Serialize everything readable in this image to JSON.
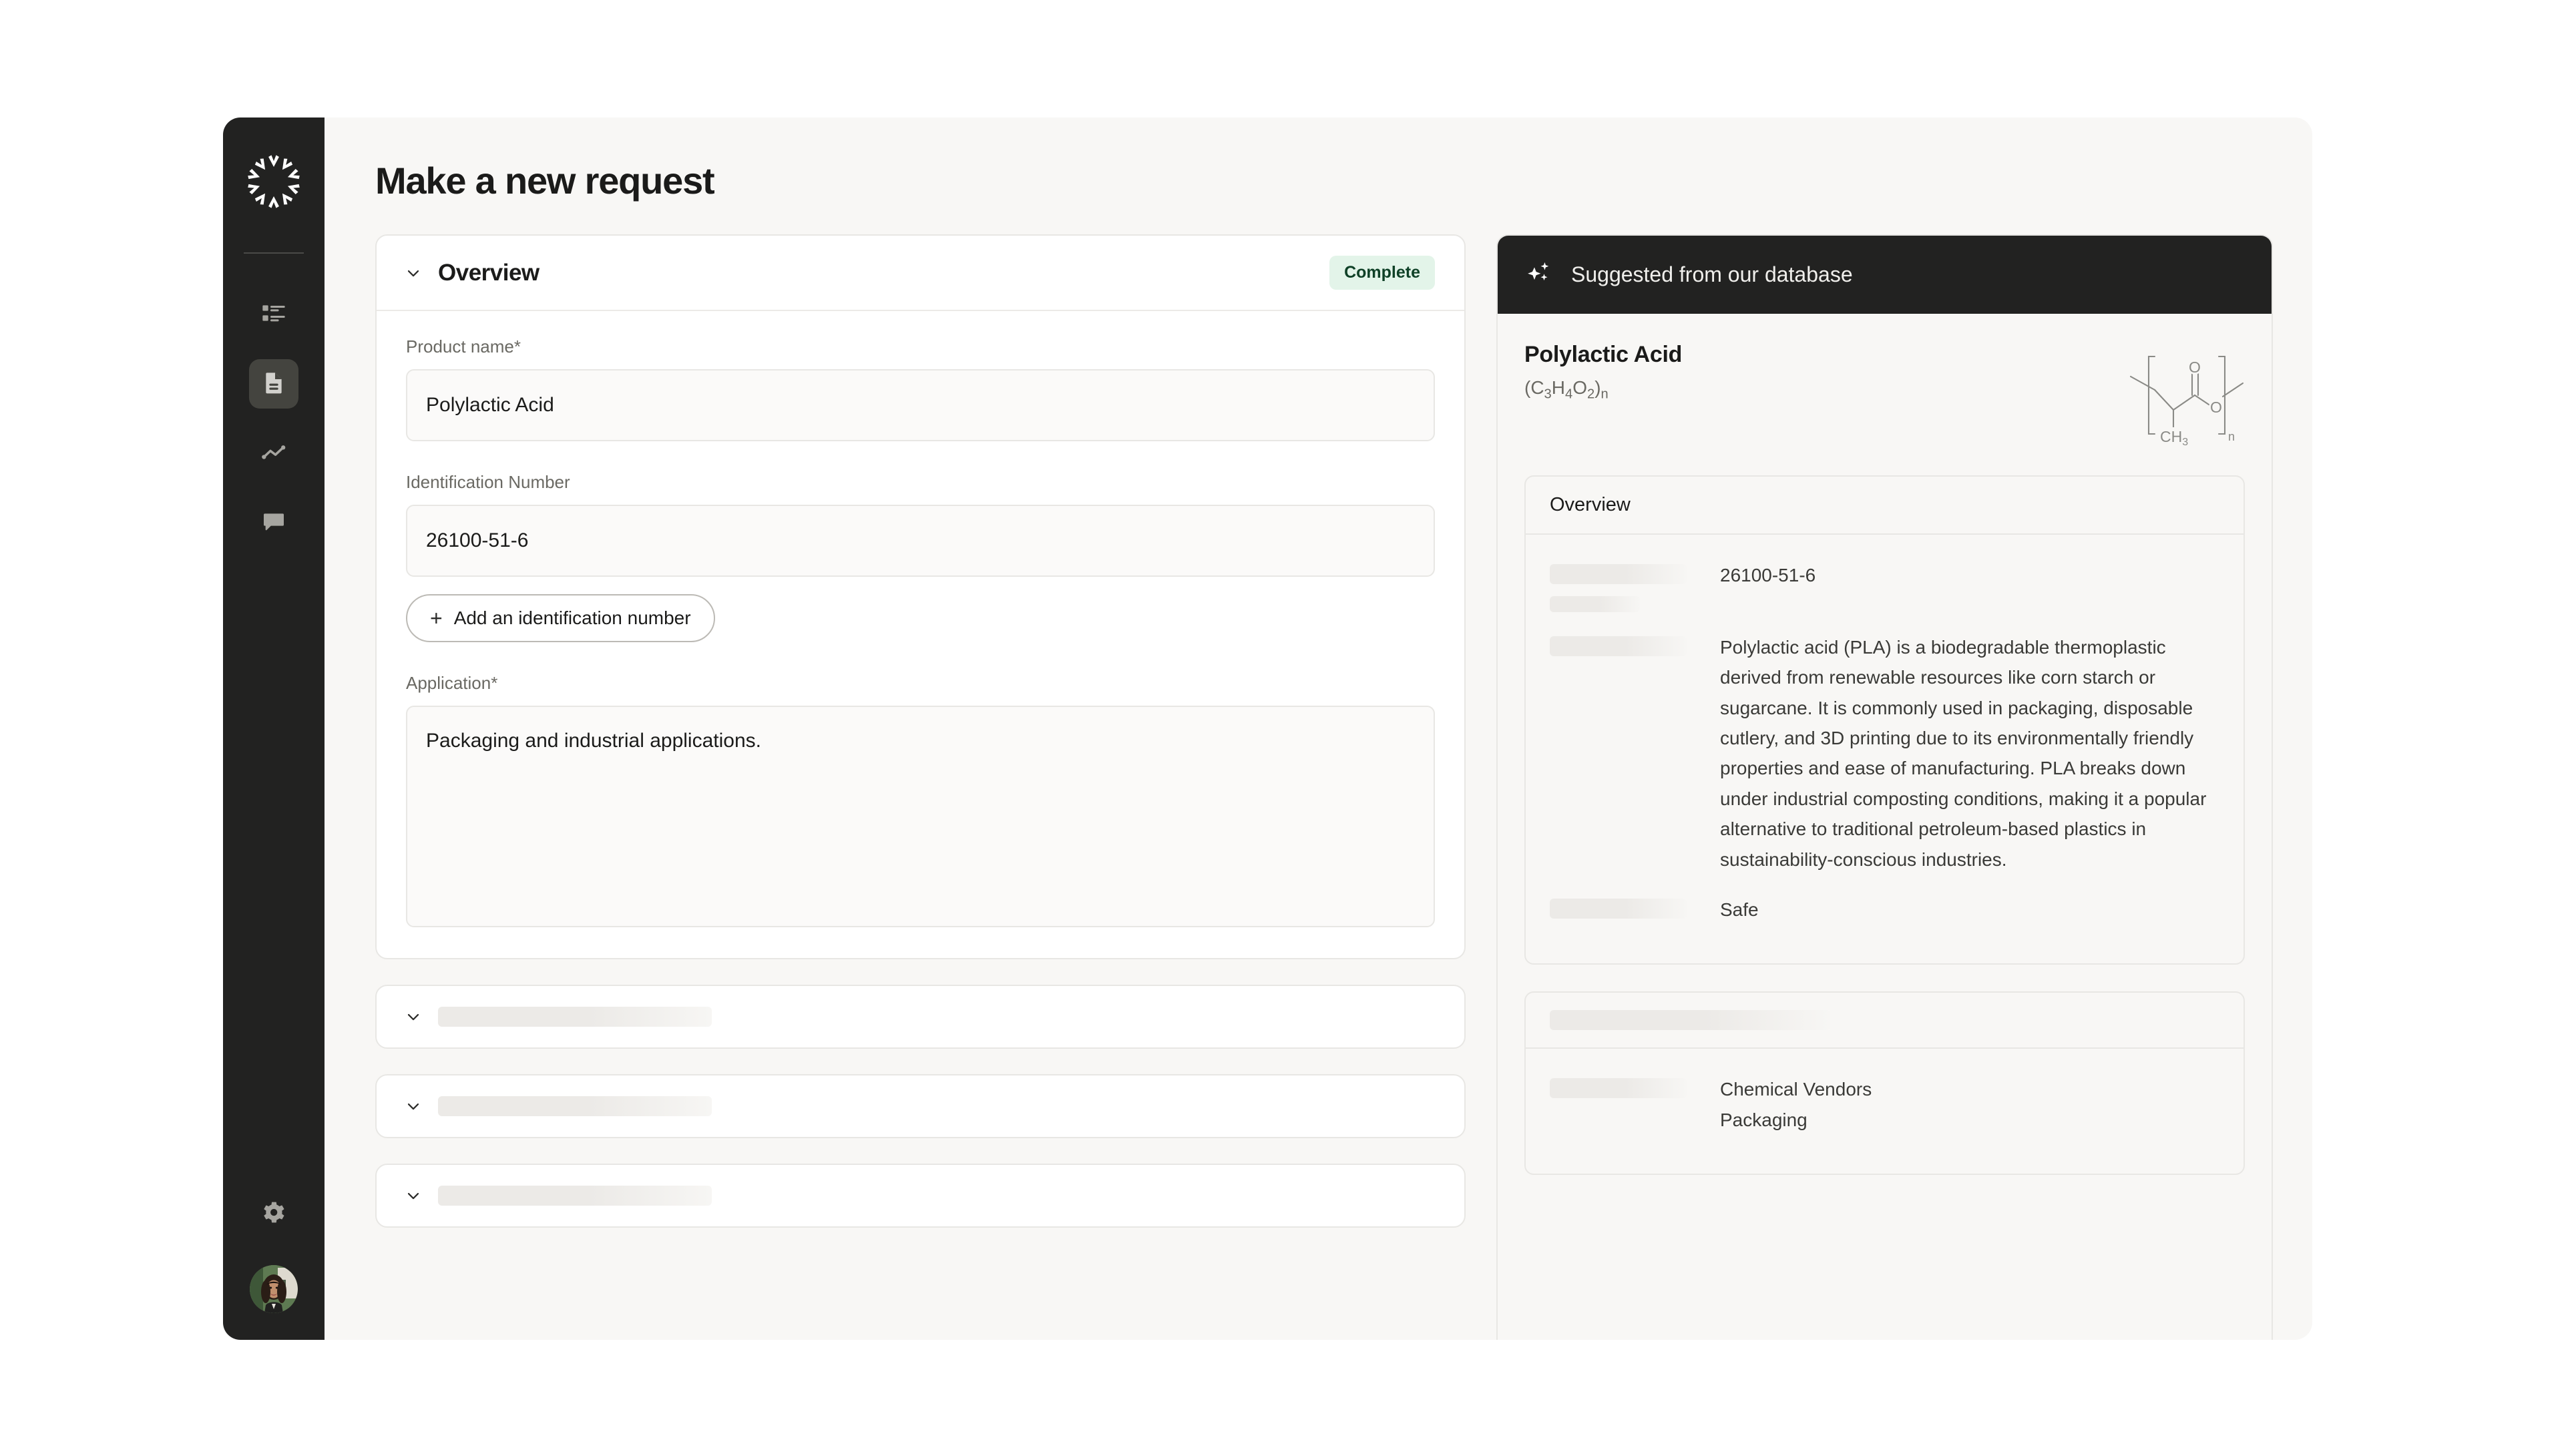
{
  "app": {
    "page_title": "Make a new request",
    "logo_name": "starburst-logo"
  },
  "sidebar": {
    "items": [
      {
        "name": "tasks-list",
        "icon": "list-icon",
        "active": false
      },
      {
        "name": "documents",
        "icon": "document-icon",
        "active": true
      },
      {
        "name": "analytics",
        "icon": "trend-line-icon",
        "active": false
      },
      {
        "name": "messages",
        "icon": "chat-bubble-icon",
        "active": false
      }
    ],
    "bottom_items": [
      {
        "name": "settings",
        "icon": "gear-icon"
      },
      {
        "name": "user-avatar",
        "icon": "avatar-photo"
      }
    ]
  },
  "form": {
    "section": {
      "title": "Overview",
      "status_badge": "Complete",
      "badge_bg": "#e3f4e9",
      "badge_color": "#0f4127",
      "collapse_icon": "chevron-down-icon"
    },
    "fields": [
      {
        "label": "Product name*",
        "value": "Polylactic Acid",
        "placeholder": "Enter product name"
      },
      {
        "label": "Identification Number",
        "value": "26100-51-6",
        "placeholder": "Enter identification number"
      },
      {
        "label": "Application*",
        "value": "Packaging and industrial applications.",
        "placeholder": "Describe the application"
      }
    ],
    "add_id_button": "Add an identification number",
    "collapsed_sections": [
      {
        "name": "collapsed-section-1",
        "icon": "chevron-down-icon"
      },
      {
        "name": "collapsed-section-2",
        "icon": "chevron-down-icon"
      },
      {
        "name": "collapsed-section-3",
        "icon": "chevron-down-icon"
      }
    ]
  },
  "suggestion": {
    "header": "Suggested from our database",
    "header_icon": "sparkle-icon",
    "header_bg": "#222221",
    "compound_name": "Polylactic Acid",
    "formula_prefix": "(C",
    "formula": "(C3H4O2)n",
    "structure_icon": "pla-chemical-structure",
    "structure_labels": {
      "carbonyl_o": "O",
      "ester_o": "O",
      "methyl": "CH3",
      "repeat": "n"
    },
    "overview_card": {
      "title": "Overview",
      "rows": [
        {
          "key_skeleton": true,
          "value": "26100-51-6"
        },
        {
          "key_skeleton": true,
          "value": "Polylactic acid (PLA) is a biodegradable thermoplastic derived from renewable resources like corn starch or sugarcane. It is commonly used in packaging, disposable cutlery, and 3D printing due to its environmentally friendly properties and ease of manufacturing. PLA breaks down under industrial composting conditions, making it a popular alternative to traditional petroleum-based plastics in sustainability-conscious industries."
        },
        {
          "key_skeleton": true,
          "value": "Safe"
        }
      ]
    },
    "second_card": {
      "title_skeleton": true,
      "rows": [
        {
          "key_skeleton": true,
          "value": "Chemical Vendors\nPackaging"
        }
      ]
    }
  }
}
